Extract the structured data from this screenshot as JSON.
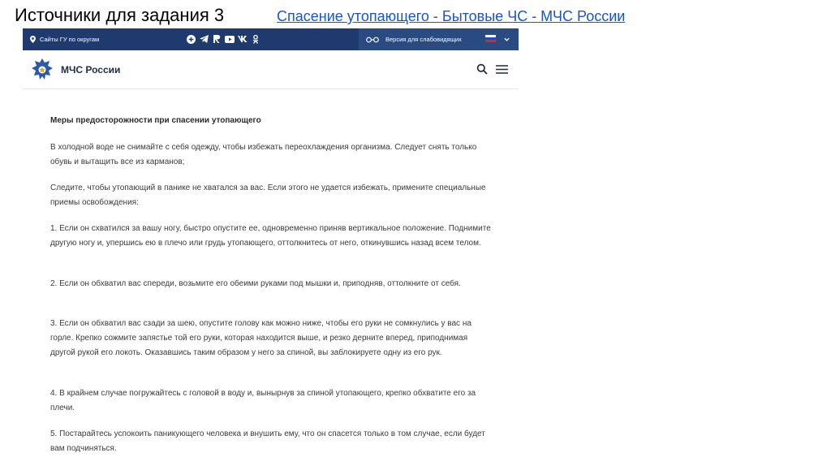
{
  "slide": {
    "title": "Источники для задания 3",
    "link_text": "Спасение утопающего - Бытовые ЧС - МЧС России"
  },
  "topbar": {
    "regions_label": "Сайты ГУ по округам",
    "social_icons": [
      "plus-circle-icon",
      "telegram-icon",
      "rutube-icon",
      "youtube-icon",
      "vk-icon",
      "ok-icon"
    ],
    "vision_label": "Версия для слабовидящих",
    "language": "ru-flag-icon",
    "colors": {
      "bar": "#1f3a6e",
      "bar_right": "#2a4a82"
    }
  },
  "header": {
    "brand": "МЧС России"
  },
  "article": {
    "heading": "Меры предосторожности при спасении утопающего",
    "paragraphs": [
      "В холодной воде не снимайте с себя одежду, чтобы избежать переохлаждения организма. Следует снять только обувь и вытащить все из карманов;",
      "Следите, чтобы утопающий в панике не хватался за вас. Если этого не удается избежать, примените специальные приемы освобождения:",
      "1. Если он схватился за вашу ногу, быстро опустите ее, одновременно приняв вертикальное положение. Поднимите другую ногу и, упершись ею в плечо или грудь утопающего, оттолкнитесь от него, откинувшись назад всем телом.",
      "2. Если он обхватил вас спереди, возьмите его обеими руками под мышки и, приподняв, оттолкните от себя.",
      "3. Если он обхватил вас сзади за шею, опустите голову как можно ниже, чтобы его руки не сомкнулись у вас на горле. Крепко сожмите запястье той его руки, которая находится выше, и резко дерните вперед, приподнимая другой рукой его локоть. Оказавшись таким образом у него за спиной, вы заблокируете одну из его рук.",
      "4. В крайнем случае погружайтесь с головой в воду и, вынырнув за спиной утопающего, крепко обхватите его за плечи.",
      "5. Постарайтесь успокоить паникующего человека и внушить ему, что он спасется только в том случае, если будет вам подчиняться."
    ]
  }
}
